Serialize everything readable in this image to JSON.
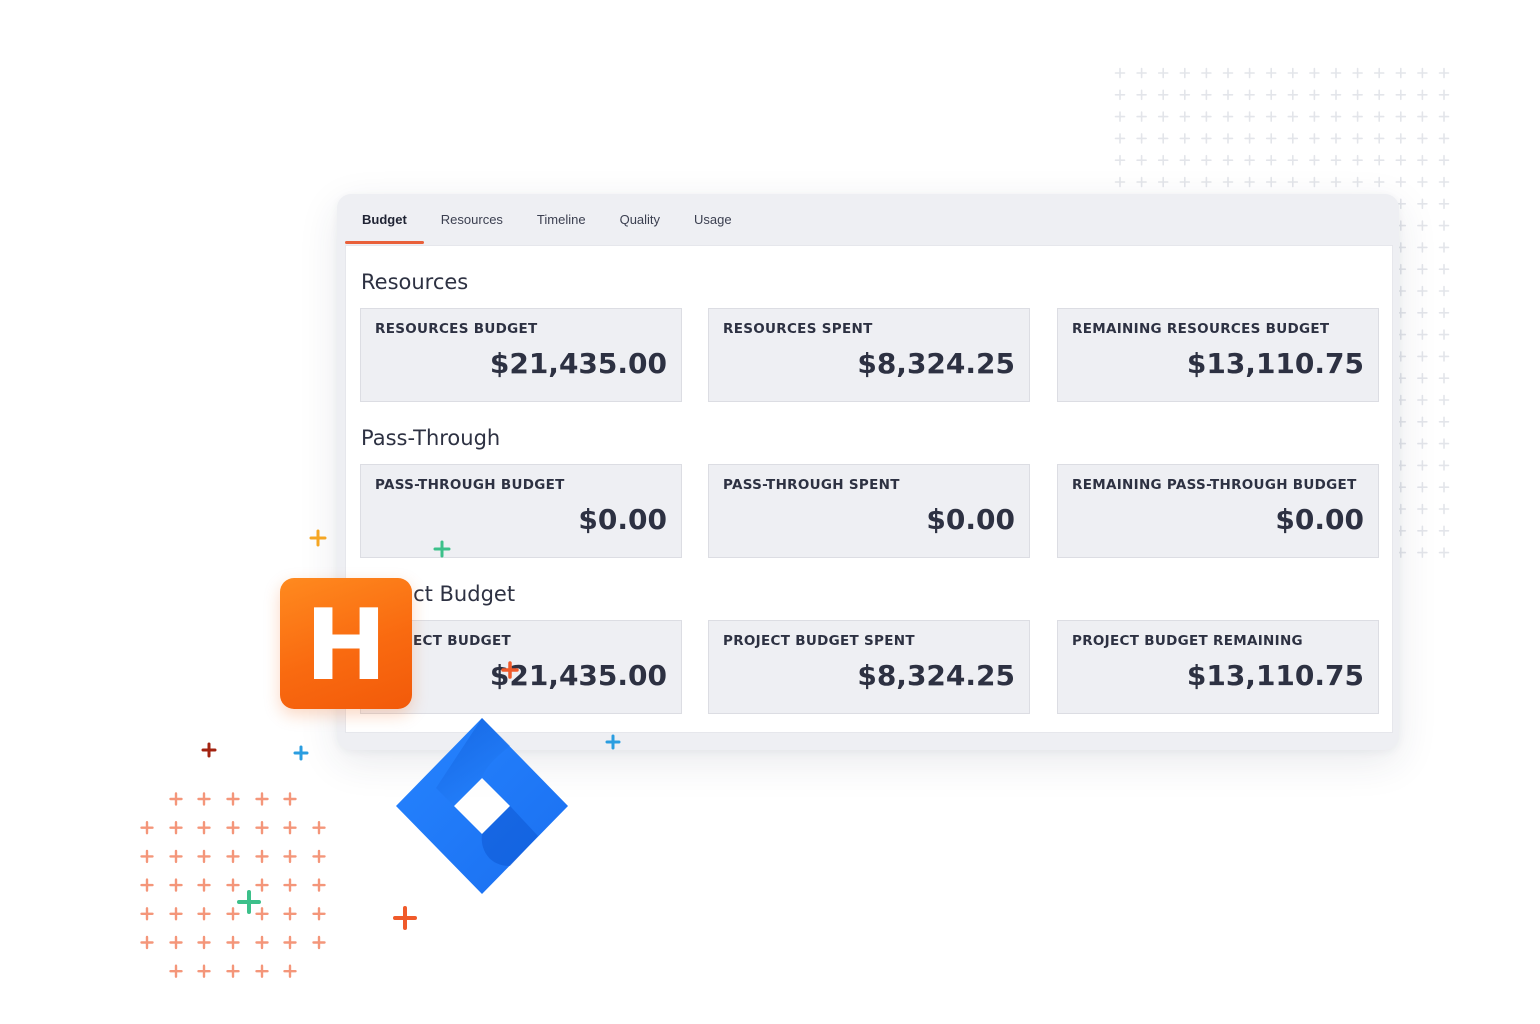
{
  "tabs": [
    {
      "label": "Budget",
      "active": true
    },
    {
      "label": "Resources"
    },
    {
      "label": "Timeline"
    },
    {
      "label": "Quality"
    },
    {
      "label": "Usage"
    }
  ],
  "sections": [
    {
      "title": "Resources",
      "metrics": [
        {
          "label": "RESOURCES BUDGET",
          "value": "$21,435.00"
        },
        {
          "label": "RESOURCES SPENT",
          "value": "$8,324.25"
        },
        {
          "label": "REMAINING RESOURCES BUDGET",
          "value": "$13,110.75"
        }
      ]
    },
    {
      "title": "Pass-Through",
      "metrics": [
        {
          "label": "PASS-THROUGH BUDGET",
          "value": "$0.00"
        },
        {
          "label": "PASS-THROUGH SPENT",
          "value": "$0.00"
        },
        {
          "label": "REMAINING PASS-THROUGH BUDGET",
          "value": "$0.00"
        }
      ]
    },
    {
      "title": "Project Budget",
      "metrics": [
        {
          "label": "PROJECT BUDGET",
          "value": "$21,435.00"
        },
        {
          "label": "PROJECT BUDGET SPENT",
          "value": "$8,324.25"
        },
        {
          "label": "PROJECT BUDGET REMAINING",
          "value": "$13,110.75"
        }
      ]
    }
  ],
  "logos": {
    "h_logo_letter": "H",
    "h_logo_color": "#f96a10",
    "jira_logo_icon": "jira-logo-icon",
    "jira_color": "#2684ff"
  },
  "colors": {
    "accent": "#e9603a",
    "text": "#2d3142",
    "card_bg": "#eeeff3"
  }
}
